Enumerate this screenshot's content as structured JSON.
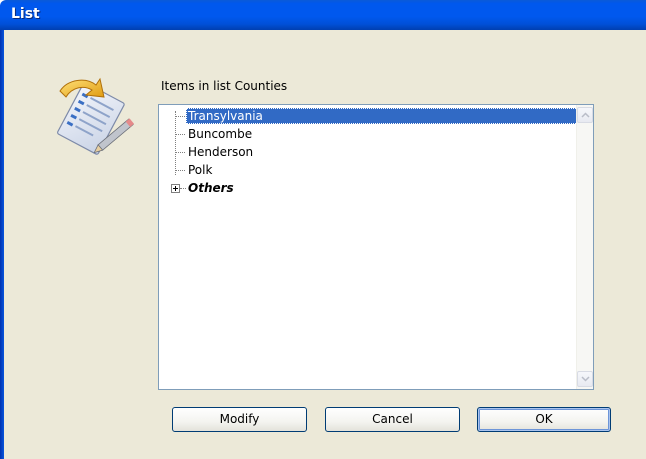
{
  "window": {
    "title": "List"
  },
  "list": {
    "label": "Items in list Counties",
    "items": [
      {
        "text": "Transylvania",
        "selected": true,
        "expandable": false,
        "style": "normal"
      },
      {
        "text": "Buncombe",
        "selected": false,
        "expandable": false,
        "style": "normal"
      },
      {
        "text": "Henderson",
        "selected": false,
        "expandable": false,
        "style": "normal"
      },
      {
        "text": "Polk",
        "selected": false,
        "expandable": false,
        "style": "normal"
      },
      {
        "text": "Others",
        "selected": false,
        "expandable": true,
        "style": "bold-italic"
      }
    ]
  },
  "buttons": {
    "modify": "Modify",
    "cancel": "Cancel",
    "ok": "OK"
  },
  "icons": {
    "app": "list-edit-icon",
    "scroll_up": "scroll-up-arrow-icon",
    "scroll_down": "scroll-down-arrow-icon",
    "expand": "expand-plus-icon"
  },
  "colors": {
    "titlebar": "#0058ee",
    "client": "#ece9d8",
    "selection": "#316ac5"
  }
}
